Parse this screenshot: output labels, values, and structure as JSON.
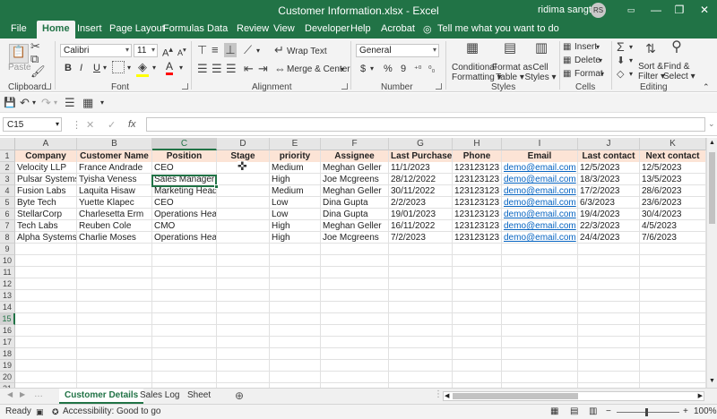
{
  "titlebar": {
    "title": "Customer Information.xlsx  -  Excel",
    "user": "ridima sangtani",
    "initials": "RS",
    "min": "—",
    "restore": "❐",
    "close": "✕"
  },
  "ribbon_tabs": [
    "File",
    "Home",
    "Insert",
    "Page Layout",
    "Formulas",
    "Data",
    "Review",
    "View",
    "Developer",
    "Help",
    "Acrobat"
  ],
  "tell_me": "Tell me what you want to do",
  "ribbon": {
    "paste": "Paste",
    "font_name": "Calibri",
    "font_size": "11",
    "bold": "B",
    "italic": "I",
    "underline": "U",
    "wrap_text": "Wrap Text",
    "merge_center": "Merge & Center",
    "number_format": "General",
    "currency": "$",
    "percent": "%",
    "comma": "9",
    "conditional_formatting": [
      "Conditional",
      "Formatting"
    ],
    "format_as_table": [
      "Format as",
      "Table"
    ],
    "cell_styles": [
      "Cell",
      "Styles"
    ],
    "insert": "Insert",
    "delete": "Delete",
    "format": "Format",
    "sort_filter": [
      "Sort &",
      "Filter"
    ],
    "find_select": [
      "Find &",
      "Select"
    ],
    "groups": [
      "Clipboard",
      "Font",
      "Alignment",
      "Number",
      "Styles",
      "Cells",
      "Editing"
    ]
  },
  "namebox": "C15",
  "columns": [
    "A",
    "B",
    "C",
    "D",
    "E",
    "F",
    "G",
    "H",
    "I",
    "J",
    "K"
  ],
  "rows": [
    "1",
    "2",
    "3",
    "4",
    "5",
    "6",
    "7",
    "8",
    "9",
    "10",
    "11",
    "12",
    "13",
    "14",
    "15",
    "16",
    "17",
    "18",
    "19",
    "20",
    "21"
  ],
  "table": {
    "headers": [
      "Company",
      "Customer Name",
      "Position",
      "Stage",
      "priority",
      "Assignee",
      "Last Purchase",
      "Phone",
      "Email",
      "Last contact",
      "Next contact"
    ],
    "rows": [
      [
        "Velocity LLP",
        "France Andrade",
        "CEO",
        "",
        "Medium",
        "Meghan Geller",
        "11/1/2023",
        "123123123",
        "demo@email.com",
        "12/5/2023",
        "12/5/2023"
      ],
      [
        "Pulsar Systems",
        "Tyisha Veness",
        "Sales Manager",
        "",
        "High",
        "Joe Mcgreens",
        "28/12/2022",
        "123123123",
        "demo@email.com",
        "18/3/2023",
        "13/5/2023"
      ],
      [
        "Fusion Labs",
        "Laquita Hisaw",
        "Marketing Head",
        "",
        "Medium",
        "Meghan Geller",
        "30/11/2022",
        "123123123",
        "demo@email.com",
        "17/2/2023",
        "28/6/2023"
      ],
      [
        "Byte Tech",
        "Yuette Klapec",
        "CEO",
        "",
        "Low",
        "Dina Gupta",
        "2/2/2023",
        "123123123",
        "demo@email.com",
        "6/3/2023",
        "23/6/2023"
      ],
      [
        "StellarCorp",
        "Charlesetta Erm",
        "Operations Head",
        "",
        "Low",
        "Dina Gupta",
        "19/01/2023",
        "123123123",
        "demo@email.com",
        "19/4/2023",
        "30/4/2023"
      ],
      [
        "Tech Labs",
        "Reuben Cole",
        "CMO",
        "",
        "High",
        "Meghan Geller",
        "16/11/2022",
        "123123123",
        "demo@email.com",
        "22/3/2023",
        "4/5/2023"
      ],
      [
        "Alpha Systems",
        "Charlie Moses",
        "Operations Head",
        "",
        "High",
        "Joe Mcgreens",
        "7/2/2023",
        "123123123",
        "demo@email.com",
        "24/4/2023",
        "7/6/2023"
      ]
    ]
  },
  "sheets": [
    "Customer Details",
    "Sales Log",
    "Sheet"
  ],
  "status": {
    "ready": "Ready",
    "accessibility": "Accessibility: Good to go",
    "zoom": "100%"
  },
  "colors": {
    "excel_green": "#217346",
    "header_fill": "#fce4d6",
    "link": "#0563c1"
  }
}
